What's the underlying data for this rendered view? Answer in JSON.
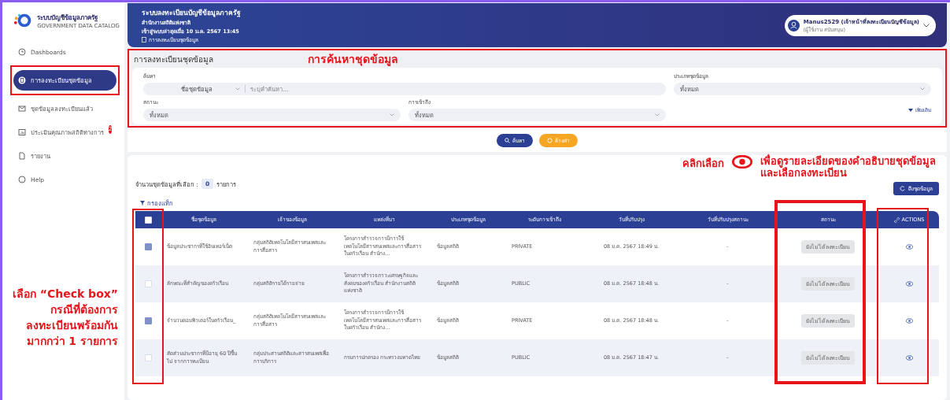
{
  "sidebar": {
    "logo_title": "ระบบบัญชีข้อมูลภาครัฐ",
    "logo_subtitle": "GOVERNMENT DATA CATALOG",
    "items": [
      {
        "label": "Dashboards",
        "selected": false
      },
      {
        "label": "การลงทะเบียนชุดข้อมูล",
        "selected": true
      },
      {
        "label": "ชุดข้อมูลลงทะเบียนแล้ว",
        "selected": false
      },
      {
        "label": "ประเมินคุณภาพสถิติทางการ",
        "selected": false,
        "badge": "2"
      },
      {
        "label": "รายงาน",
        "selected": false
      },
      {
        "label": "Help",
        "selected": false
      }
    ]
  },
  "header": {
    "title": "ระบบลงทะเบียนบัญชีข้อมูลภาครัฐ",
    "org": "สำนักงานสถิติแห่งชาติ",
    "last_login": "เข้าสู่ระบบล่าสุดเมื่อ 10 ม.ค. 2567 13:45",
    "breadcrumb": "การลงทะเบียนชุดข้อมูล",
    "user": {
      "name": "Manus2529 (เจ้าหน้าที่ลงทะเบียนบัญชีข้อมูล)",
      "role": "(ผู้ใช้งาน สนับสนุน)"
    }
  },
  "search_panel": {
    "title": "การลงทะเบียนชุดข้อมูล",
    "annotation": "การค้นหาชุดข้อมูล",
    "search": {
      "label": "ค้นหา",
      "select_value": "ชื่อชุดข้อมูล",
      "placeholder": "ระบุคำค้นหา..."
    },
    "dataset_type": {
      "label": "ประเภทชุดข้อมูล",
      "value": "ทั้งหมด"
    },
    "status": {
      "label": "สถานะ",
      "value": "ทั้งหมด"
    },
    "access": {
      "label": "การเข้าถึง",
      "value": "ทั้งหมด"
    },
    "more": "เพิ่มเติม"
  },
  "buttons": [
    {
      "label": "ค้นหา",
      "kind": "search"
    },
    {
      "label": "ล้างค่า",
      "kind": "reset"
    }
  ],
  "results": {
    "selected_label": "จำนวนชุดข้อมูลที่เลือก :",
    "selected_count": "0",
    "selected_unit": "รายการ",
    "fetch_button": "ดึงชุดข้อมูล",
    "tag_filter": "กรองแท็ก",
    "annotation": {
      "prefix": "คลิกเลือก",
      "lines": [
        "เพื่อดูรายละเอียดของคำอธิบายชุดข้อมูล",
        "และเลือกลงทะเบียน"
      ]
    },
    "table": {
      "select_all_checked": false,
      "columns": [
        "ชื่อชุดข้อมูล",
        "เจ้าของข้อมูล",
        "แหล่งที่มา",
        "ประเภทชุดข้อมูล",
        "ระดับการเข้าถึง",
        "วันที่ปรับปรุง",
        "วันที่ปรับปรุงสถานะ",
        "สถานะ",
        "ACTIONS"
      ],
      "rows": [
        {
          "checked": true,
          "cells": [
            "ข้อมูลประชากรที่ใช้อินเทอร์เน็ต",
            "กลุ่มสถิติเทคโนโลยีสารสนเทศและการสื่อสาร",
            "โครงการสำรวจการมีการใช้เทคโนโลยีสารสนเทศและการสื่อสารในครัวเรือน สำนักง...",
            "ข้อมูลสถิติ",
            "PRIVATE",
            "08 ม.ค. 2567 18:49 น.",
            "-"
          ],
          "status": "ยังไม่ได้ลงทะเบียน"
        },
        {
          "checked": false,
          "cells": [
            "ลักษณะที่สำคัญของครัวเรือน",
            "กลุ่มสถิติรายได้รายจ่าย",
            "โครงการสำรวจภาวะเศรษฐกิจและสังคมของครัวเรือน สำนักงานสถิติแห่งชาติ",
            "ข้อมูลสถิติ",
            "PUBLIC",
            "08 ม.ค. 2567 18:48 น.",
            "-"
          ],
          "status": "ยังไม่ได้ลงทะเบียน"
        },
        {
          "checked": true,
          "cells": [
            "จำนวนคอมพิวเตอร์ในครัวเรือน_",
            "กลุ่มสถิติเทคโนโลยีสารสนเทศและการสื่อสาร",
            "โครงการสำรวจการมีการใช้เทคโนโลยีสารสนเทศและการสื่อสารในครัวเรือน สำนักง...",
            "ข้อมูลสถิติ",
            "PRIVATE",
            "08 ม.ค. 2567 18:48 น.",
            "-"
          ],
          "status": "ยังไม่ได้ลงทะเบียน"
        },
        {
          "checked": false,
          "cells": [
            "สัดส่วนประชากรที่มีอายุ 60 ปีขึ้นไป จากการทะเบียน",
            "กลุ่มประสานสถิติและสารสนเทศเพื่อการบริการ",
            "กรมการปกครอง กระทรวงมหาดไทย",
            "ข้อมูลสถิติ",
            "PUBLIC",
            "08 ม.ค. 2567 18:47 น.",
            "-"
          ],
          "status": "ยังไม่ได้ลงทะเบียน"
        }
      ]
    }
  },
  "side_note": [
    "เลือก “Check box”",
    "กรณีที่ต้องการ",
    "ลงทะเบียนพร้อมกัน",
    "มากกว่า 1 รายการ"
  ]
}
